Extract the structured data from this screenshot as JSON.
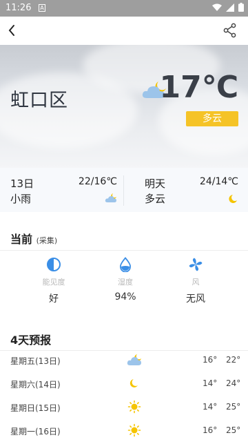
{
  "status_bar": {
    "time": "11:26",
    "badge": "A"
  },
  "location": {
    "district": "虹口区"
  },
  "current": {
    "temperature": "17℃",
    "condition": "多云",
    "icon": "partly-cloudy-night-icon"
  },
  "days": [
    {
      "label": "13日",
      "range": "22/16℃",
      "condition": "小雨",
      "icon": "cloud-moon-icon"
    },
    {
      "label": "明天",
      "range": "24/14℃",
      "condition": "多云",
      "icon": "moon-icon"
    }
  ],
  "now_section": {
    "title": "当前",
    "subtitle": "(采集)",
    "metrics": [
      {
        "icon": "visibility-icon",
        "label": "能见度",
        "value": "好"
      },
      {
        "icon": "humidity-icon",
        "label": "湿度",
        "value": "94%"
      },
      {
        "icon": "wind-icon",
        "label": "风",
        "value": "无风"
      }
    ]
  },
  "forecast": {
    "title": "4天预报",
    "rows": [
      {
        "day": "星期五(13日)",
        "icon": "cloud-moon-icon",
        "low": "16°",
        "high": "22°"
      },
      {
        "day": "星期六(14日)",
        "icon": "moon-icon",
        "low": "14°",
        "high": "24°"
      },
      {
        "day": "星期日(15日)",
        "icon": "sun-icon",
        "low": "14°",
        "high": "25°"
      },
      {
        "day": "星期一(16日)",
        "icon": "sun-icon",
        "low": "16°",
        "high": "25°"
      }
    ]
  },
  "colors": {
    "accent_yellow": "#f5c327",
    "cloud_blue": "#9cc4ea",
    "moon_yellow": "#f5c400",
    "metric_blue": "#3a8ee6"
  }
}
